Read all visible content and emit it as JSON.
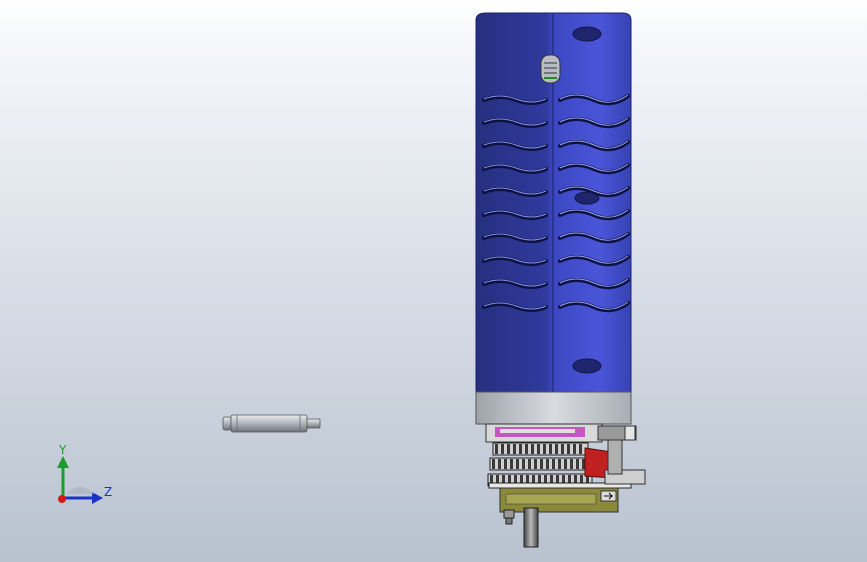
{
  "viewport": {
    "background_top": "#ffffff",
    "background_bottom": "#b8c2cf"
  },
  "triad": {
    "y_label": "Y",
    "z_label": "Z",
    "y_color": "#1f9a2e",
    "z_color": "#1b34c8",
    "x_color": "#d21a1a"
  },
  "model": {
    "housing_color": "#3c47c2",
    "housing_shadow_color": "#2c3496",
    "housing_highlight_color": "#5a66e6",
    "end_cap_color": "#c9ccd2",
    "gear_color": "#3a3a3a",
    "bracket_color": "#8a8a3a",
    "accent_color": "#c02020",
    "magenta_color": "#c040c0"
  },
  "parts": [
    "loose-shaft-pin",
    "motor-housing",
    "gear-assembly"
  ]
}
